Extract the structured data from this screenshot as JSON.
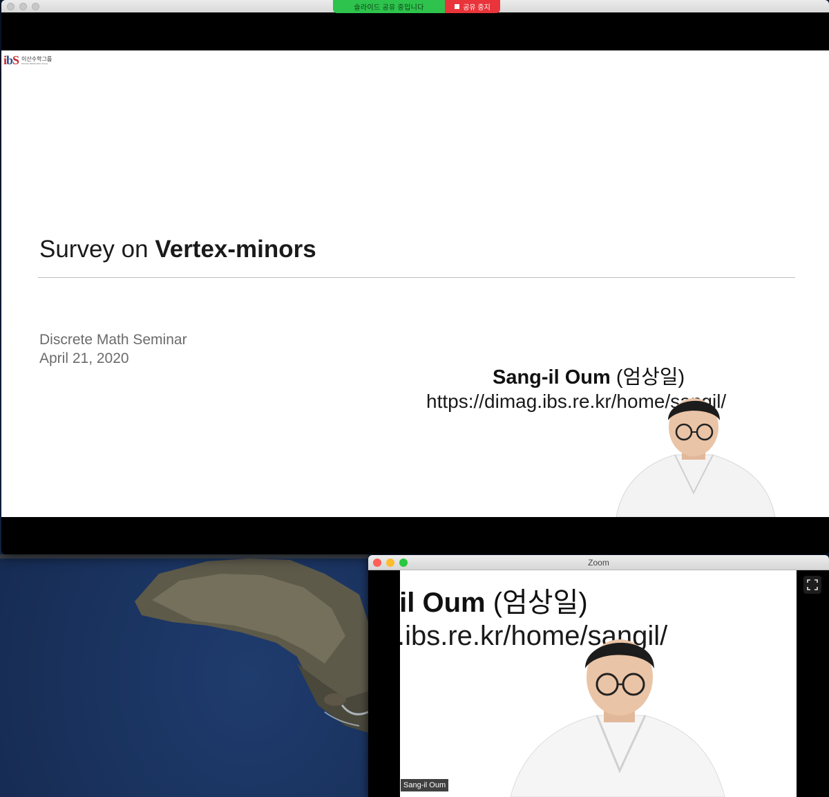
{
  "sharing_bar": {
    "status_text": "슬라이드 공유 중입니다",
    "stop_label": "공유 중지",
    "status_color": "#2ec34c",
    "stop_color": "#e8343a"
  },
  "slide": {
    "logo": {
      "mark_i": "i",
      "mark_b": "b",
      "mark_s": "S",
      "kr": "이산수학그룹",
      "en": "Discrete Mathematics Group"
    },
    "title_regular": "Survey on ",
    "title_bold": "Vertex-minors",
    "event": "Discrete Math Seminar",
    "date": "April 21, 2020",
    "speaker_name": "Sang-il Oum",
    "speaker_korean": " (엄상일)",
    "url": "https://dimag.ibs.re.kr/home/sangil/"
  },
  "zoom_window": {
    "title": "Zoom",
    "name_overlay": "Sang-il Oum",
    "video_name": "Sang-il Oum",
    "video_korean": " (엄상일)",
    "video_url": "https://dimag.ibs.re.kr/home/sangil/",
    "fullscreen_icon": "fullscreen-icon"
  }
}
